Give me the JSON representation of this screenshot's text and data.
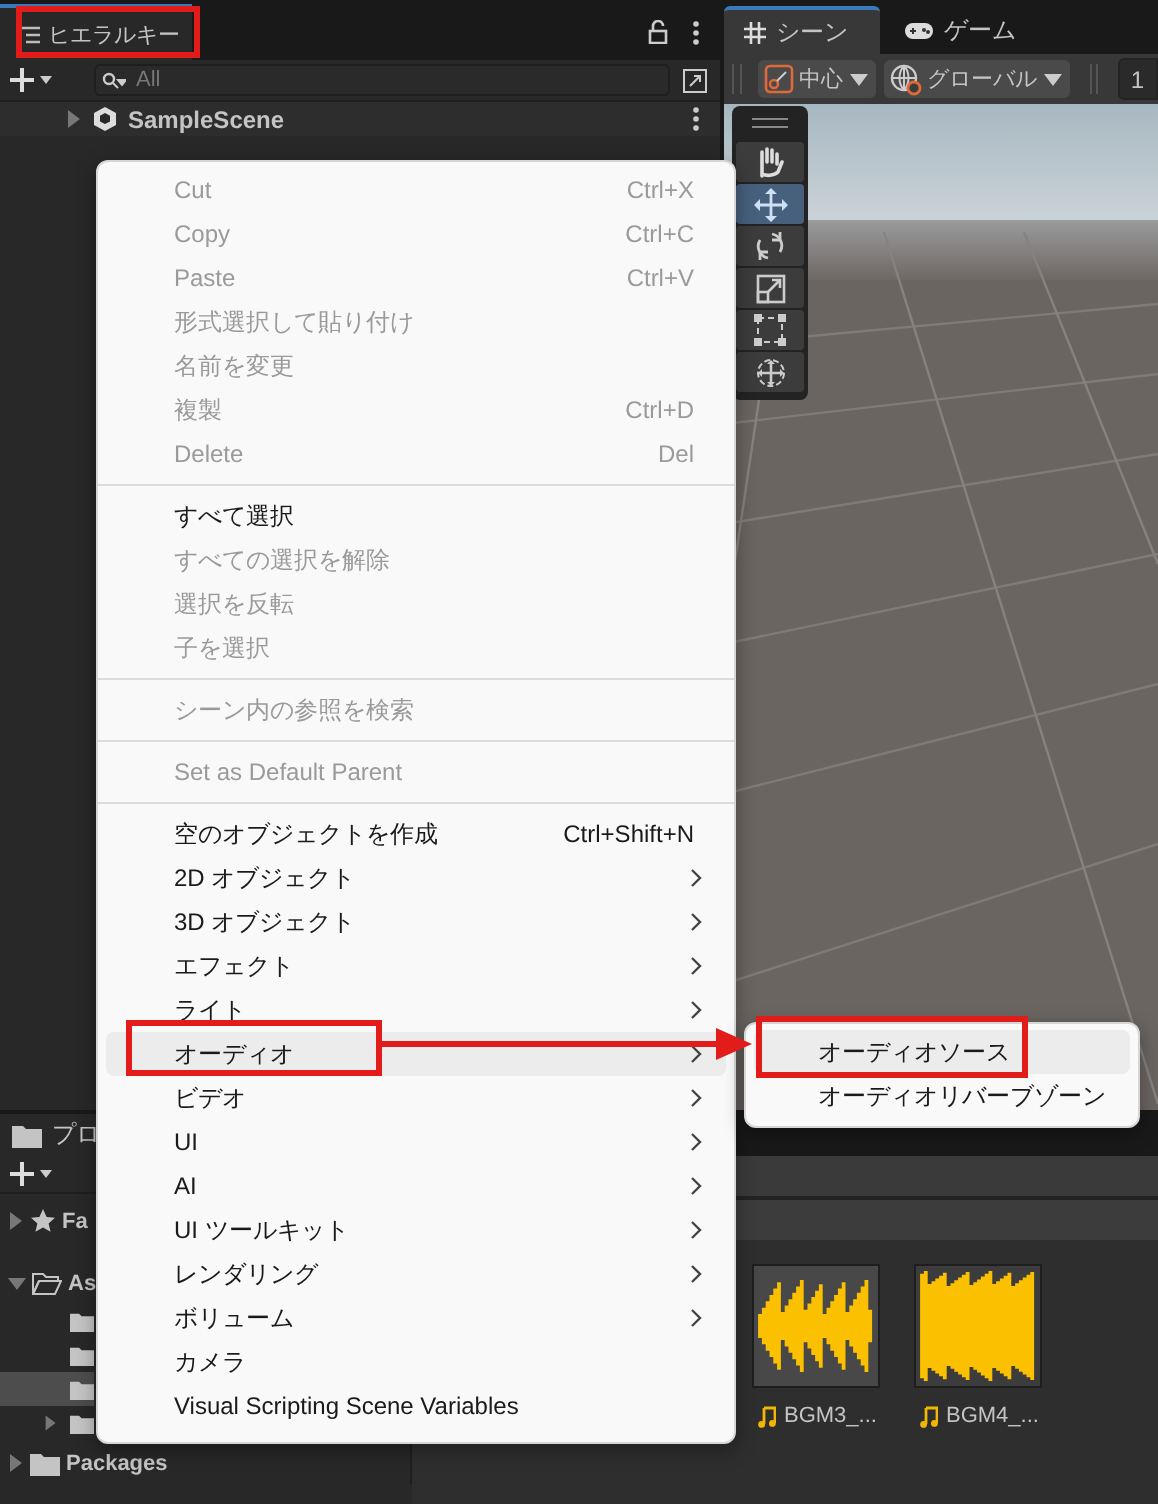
{
  "hierarchy": {
    "title": "ヒエラルキー",
    "search": {
      "placeholder": "All"
    },
    "items": [
      {
        "label": "SampleScene",
        "expanded": false
      }
    ]
  },
  "scene": {
    "tabs": [
      {
        "label": "シーン",
        "kind": "scene",
        "selected": true
      },
      {
        "label": "ゲーム",
        "kind": "game",
        "selected": false
      }
    ],
    "pivot": "中心",
    "space": "グローバル",
    "snap_value": "1",
    "tools": [
      {
        "kind": "hand",
        "selected": false
      },
      {
        "kind": "move",
        "selected": true
      },
      {
        "kind": "rotate",
        "selected": false
      },
      {
        "kind": "scale",
        "selected": false
      },
      {
        "kind": "rect",
        "selected": false
      },
      {
        "kind": "transform",
        "selected": false
      }
    ]
  },
  "project": {
    "title": "プロ",
    "tree": [
      {
        "kind": "favorites",
        "label": "Fa",
        "expanded": false
      },
      {
        "kind": "folder",
        "label": "As",
        "expanded": true,
        "children": [
          {
            "expandable": false,
            "selected": false
          },
          {
            "expandable": false,
            "selected": false
          },
          {
            "expandable": false,
            "selected": true
          },
          {
            "expandable": true,
            "selected": false
          }
        ]
      },
      {
        "kind": "folder",
        "label": "Packages",
        "expanded": false
      }
    ],
    "assets": [
      {
        "kind": "audio",
        "label": "BGM3_..."
      },
      {
        "kind": "audio",
        "label": "BGM4_..."
      }
    ]
  },
  "context_menu": {
    "items": [
      {
        "kind": "item",
        "label": "Cut",
        "shortcut": "Ctrl+X",
        "disabled": true,
        "submenu": false,
        "selected": false
      },
      {
        "kind": "item",
        "label": "Copy",
        "shortcut": "Ctrl+C",
        "disabled": true,
        "submenu": false,
        "selected": false
      },
      {
        "kind": "item",
        "label": "Paste",
        "shortcut": "Ctrl+V",
        "disabled": true,
        "submenu": false,
        "selected": false
      },
      {
        "kind": "item",
        "label": "形式選択して貼り付け",
        "disabled": true,
        "submenu": false,
        "selected": false
      },
      {
        "kind": "item",
        "label": "名前を変更",
        "disabled": true,
        "submenu": false,
        "selected": false
      },
      {
        "kind": "item",
        "label": "複製",
        "shortcut": "Ctrl+D",
        "disabled": true,
        "submenu": false,
        "selected": false
      },
      {
        "kind": "item",
        "label": "Delete",
        "shortcut": "Del",
        "disabled": true,
        "submenu": false,
        "selected": false
      },
      {
        "kind": "separator"
      },
      {
        "kind": "item",
        "label": "すべて選択",
        "disabled": false,
        "submenu": false,
        "selected": false
      },
      {
        "kind": "item",
        "label": "すべての選択を解除",
        "disabled": true,
        "submenu": false,
        "selected": false
      },
      {
        "kind": "item",
        "label": "選択を反転",
        "disabled": true,
        "submenu": false,
        "selected": false
      },
      {
        "kind": "item",
        "label": "子を選択",
        "disabled": true,
        "submenu": false,
        "selected": false
      },
      {
        "kind": "separator"
      },
      {
        "kind": "item",
        "label": "シーン内の参照を検索",
        "disabled": true,
        "submenu": false,
        "selected": false
      },
      {
        "kind": "separator"
      },
      {
        "kind": "item",
        "label": "Set as Default Parent",
        "disabled": true,
        "submenu": false,
        "selected": false
      },
      {
        "kind": "separator"
      },
      {
        "kind": "item",
        "label": "空のオブジェクトを作成",
        "shortcut": "Ctrl+Shift+N",
        "disabled": false,
        "submenu": false,
        "selected": false
      },
      {
        "kind": "item",
        "label": "2D オブジェクト",
        "disabled": false,
        "submenu": true,
        "selected": false
      },
      {
        "kind": "item",
        "label": "3D オブジェクト",
        "disabled": false,
        "submenu": true,
        "selected": false
      },
      {
        "kind": "item",
        "label": "エフェクト",
        "disabled": false,
        "submenu": true,
        "selected": false
      },
      {
        "kind": "item",
        "label": "ライト",
        "disabled": false,
        "submenu": true,
        "selected": false
      },
      {
        "kind": "item",
        "label": "オーディオ",
        "disabled": false,
        "submenu": true,
        "selected": true
      },
      {
        "kind": "item",
        "label": "ビデオ",
        "disabled": false,
        "submenu": true,
        "selected": false
      },
      {
        "kind": "item",
        "label": "UI",
        "disabled": false,
        "submenu": true,
        "selected": false
      },
      {
        "kind": "item",
        "label": "AI",
        "disabled": false,
        "submenu": true,
        "selected": false
      },
      {
        "kind": "item",
        "label": "UI ツールキット",
        "disabled": false,
        "submenu": true,
        "selected": false
      },
      {
        "kind": "item",
        "label": "レンダリング",
        "disabled": false,
        "submenu": true,
        "selected": false
      },
      {
        "kind": "item",
        "label": "ボリューム",
        "disabled": false,
        "submenu": true,
        "selected": false
      },
      {
        "kind": "item",
        "label": "カメラ",
        "disabled": false,
        "submenu": false,
        "selected": false
      },
      {
        "kind": "item",
        "label": "Visual Scripting Scene Variables",
        "disabled": false,
        "submenu": false,
        "selected": false
      }
    ]
  },
  "submenu": {
    "items": [
      {
        "label": "オーディオソース",
        "selected": true
      },
      {
        "label": "オーディオリバーブゾーン",
        "selected": false
      }
    ]
  }
}
